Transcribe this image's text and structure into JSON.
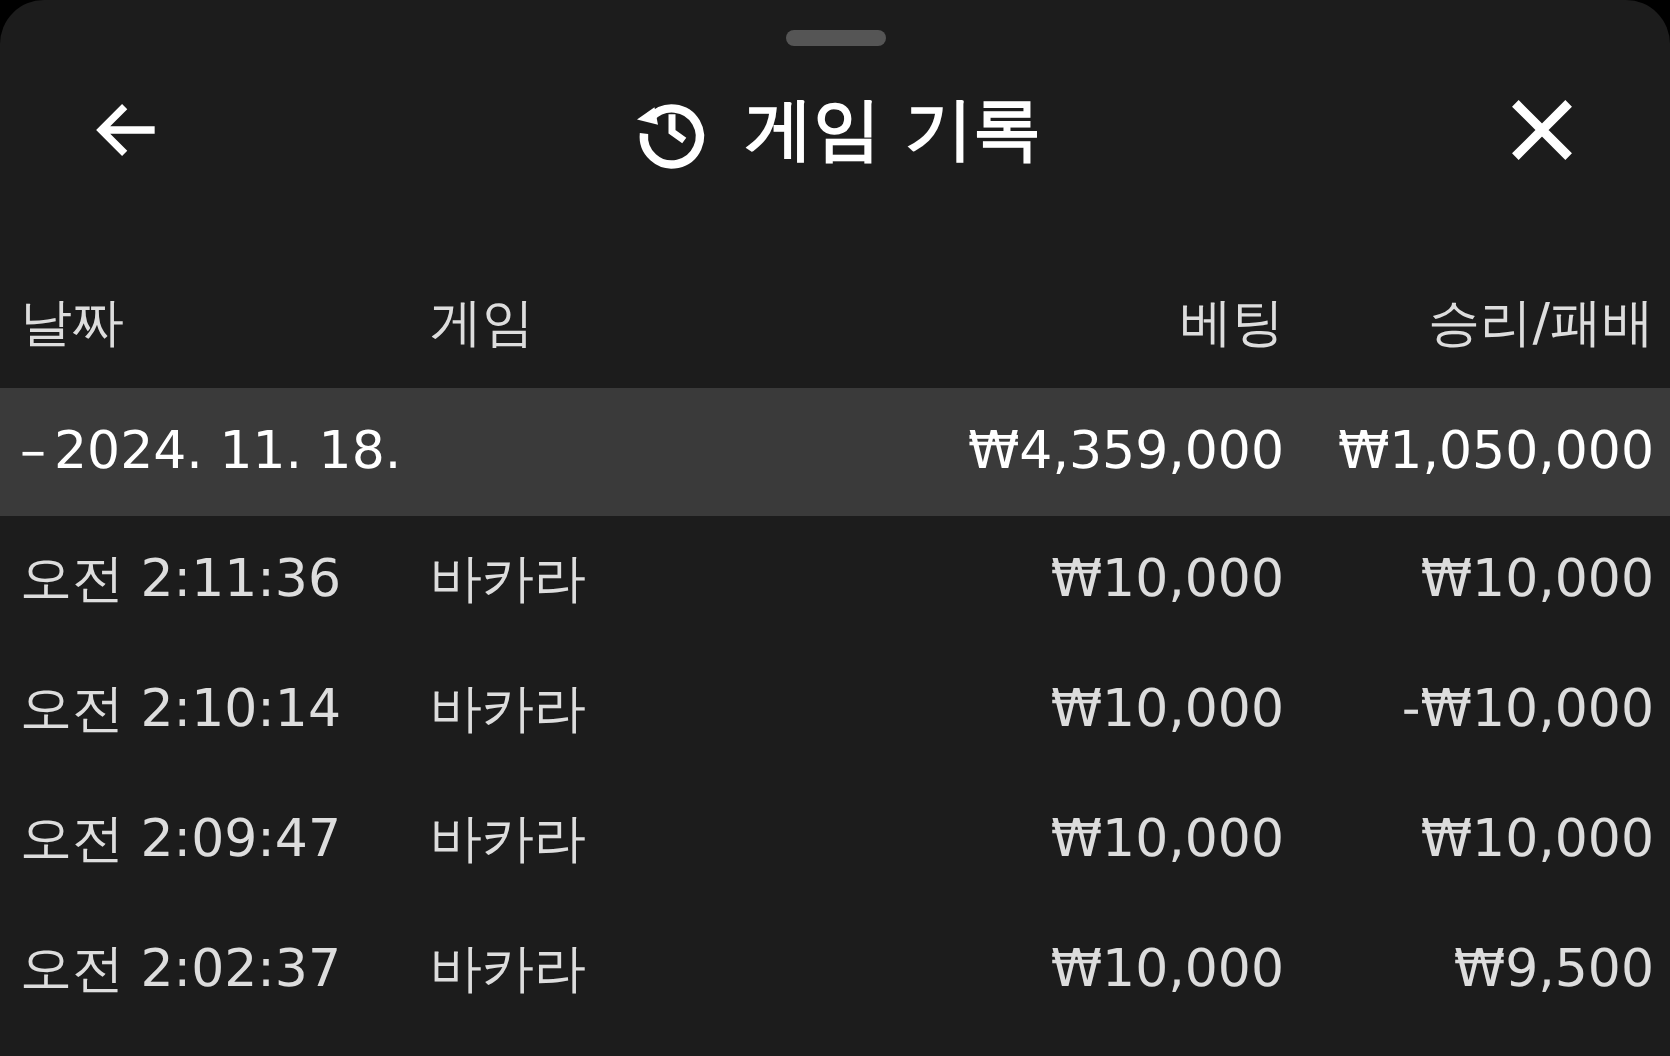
{
  "header": {
    "title": "게임 기록"
  },
  "table": {
    "columns": [
      "날짜",
      "게임",
      "베팅",
      "승리/패배"
    ],
    "group": {
      "toggle": "–",
      "date": "2024. 11. 18.",
      "bet": "₩4,359,000",
      "result": "₩1,050,000"
    },
    "rows": [
      {
        "time": "오전 2:11:36",
        "game": "바카라",
        "bet": "₩10,000",
        "result": "₩10,000"
      },
      {
        "time": "오전 2:10:14",
        "game": "바카라",
        "bet": "₩10,000",
        "result": "-₩10,000"
      },
      {
        "time": "오전 2:09:47",
        "game": "바카라",
        "bet": "₩10,000",
        "result": "₩10,000"
      },
      {
        "time": "오전 2:02:37",
        "game": "바카라",
        "bet": "₩10,000",
        "result": "₩9,500"
      }
    ]
  }
}
